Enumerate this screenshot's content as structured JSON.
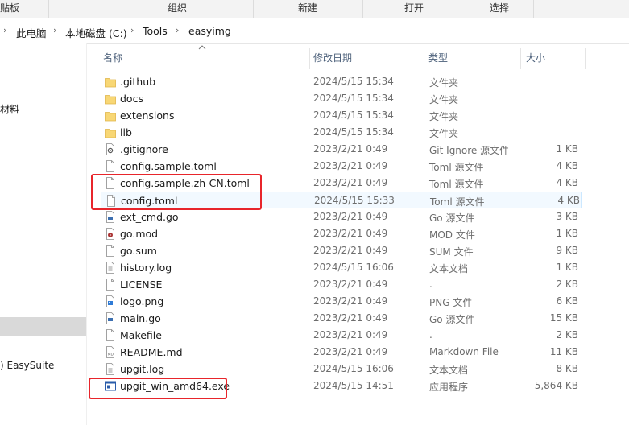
{
  "ribbon": {
    "groups": [
      "贴板",
      "组织",
      "新建",
      "打开",
      "选择"
    ]
  },
  "address_bar": {
    "crumbs": [
      "此电脑",
      "本地磁盘 (C:)",
      "Tools",
      "easyimg"
    ]
  },
  "nav_pane": {
    "items": [
      "材料",
      ") EasySuite"
    ]
  },
  "columns": {
    "name": "名称",
    "date": "修改日期",
    "type": "类型",
    "size": "大小"
  },
  "files": [
    {
      "name": ".github",
      "date": "2024/5/15 15:34",
      "type": "文件夹",
      "size": "",
      "icon": "folder-icon"
    },
    {
      "name": "docs",
      "date": "2024/5/15 15:34",
      "type": "文件夹",
      "size": "",
      "icon": "folder-icon"
    },
    {
      "name": "extensions",
      "date": "2024/5/15 15:34",
      "type": "文件夹",
      "size": "",
      "icon": "folder-icon"
    },
    {
      "name": "lib",
      "date": "2024/5/15 15:34",
      "type": "文件夹",
      "size": "",
      "icon": "folder-icon"
    },
    {
      "name": ".gitignore",
      "date": "2023/2/21 0:49",
      "type": "Git Ignore 源文件",
      "size": "1 KB",
      "icon": "gear-file-icon"
    },
    {
      "name": "config.sample.toml",
      "date": "2023/2/21 0:49",
      "type": "Toml 源文件",
      "size": "4 KB",
      "icon": "file-icon"
    },
    {
      "name": "config.sample.zh-CN.toml",
      "date": "2023/2/21 0:49",
      "type": "Toml 源文件",
      "size": "4 KB",
      "icon": "file-icon"
    },
    {
      "name": "config.toml",
      "date": "2024/5/15 15:33",
      "type": "Toml 源文件",
      "size": "4 KB",
      "icon": "file-icon"
    },
    {
      "name": "ext_cmd.go",
      "date": "2023/2/21 0:49",
      "type": "Go 源文件",
      "size": "3 KB",
      "icon": "code-file-icon"
    },
    {
      "name": "go.mod",
      "date": "2023/2/21 0:49",
      "type": "MOD 文件",
      "size": "1 KB",
      "icon": "media-file-icon"
    },
    {
      "name": "go.sum",
      "date": "2023/2/21 0:49",
      "type": "SUM 文件",
      "size": "9 KB",
      "icon": "file-icon"
    },
    {
      "name": "history.log",
      "date": "2024/5/15 16:06",
      "type": "文本文档",
      "size": "1 KB",
      "icon": "text-file-icon"
    },
    {
      "name": "LICENSE",
      "date": "2023/2/21 0:49",
      "type": ".",
      "size": "2 KB",
      "icon": "file-icon"
    },
    {
      "name": "logo.png",
      "date": "2023/2/21 0:49",
      "type": "PNG 文件",
      "size": "6 KB",
      "icon": "image-file-icon"
    },
    {
      "name": "main.go",
      "date": "2023/2/21 0:49",
      "type": "Go 源文件",
      "size": "15 KB",
      "icon": "code-file-icon"
    },
    {
      "name": "Makefile",
      "date": "2023/2/21 0:49",
      "type": ".",
      "size": "2 KB",
      "icon": "file-icon"
    },
    {
      "name": "README.md",
      "date": "2023/2/21 0:49",
      "type": "Markdown File",
      "size": "11 KB",
      "icon": "markdown-file-icon"
    },
    {
      "name": "upgit.log",
      "date": "2024/5/15 16:06",
      "type": "文本文档",
      "size": "8 KB",
      "icon": "text-file-icon"
    },
    {
      "name": "upgit_win_amd64.exe",
      "date": "2024/5/15 14:51",
      "type": "应用程序",
      "size": "5,864 KB",
      "icon": "exe-file-icon"
    }
  ],
  "colors": {
    "annotation": "#e8252b",
    "folder": "#f8d775",
    "hover": "#cce8ff"
  }
}
